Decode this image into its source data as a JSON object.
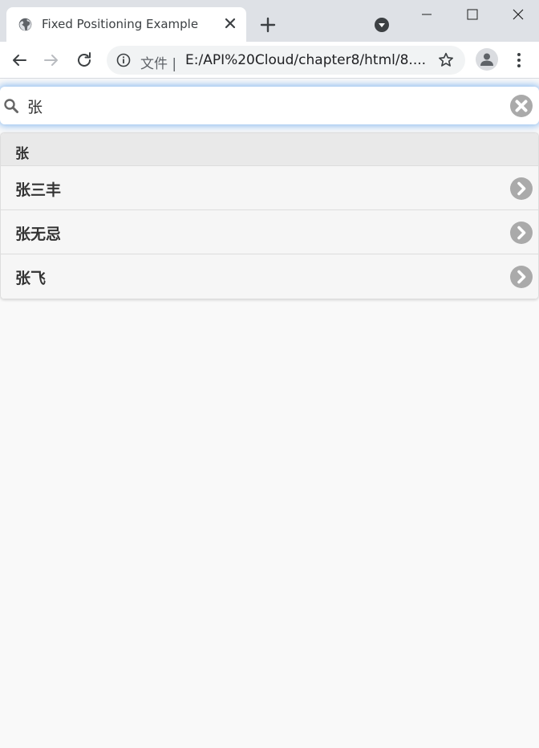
{
  "browser": {
    "tab": {
      "title": "Fixed Positioning Example",
      "favicon": "globe-icon"
    },
    "toolbar": {
      "security_chip": "文件 |",
      "url": "E:/API%20Cloud/chapter8/html/8...."
    }
  },
  "page": {
    "search": {
      "value": "张",
      "placeholder": ""
    },
    "divider_label": "张",
    "items": [
      {
        "label": "张三丰"
      },
      {
        "label": "张无忌"
      },
      {
        "label": "张飞"
      }
    ]
  },
  "colors": {
    "accent": "#388ce9",
    "list_bg": "#f6f6f6",
    "divider_bg": "#e9e9e9",
    "icon_grey": "#aaaaaa"
  }
}
